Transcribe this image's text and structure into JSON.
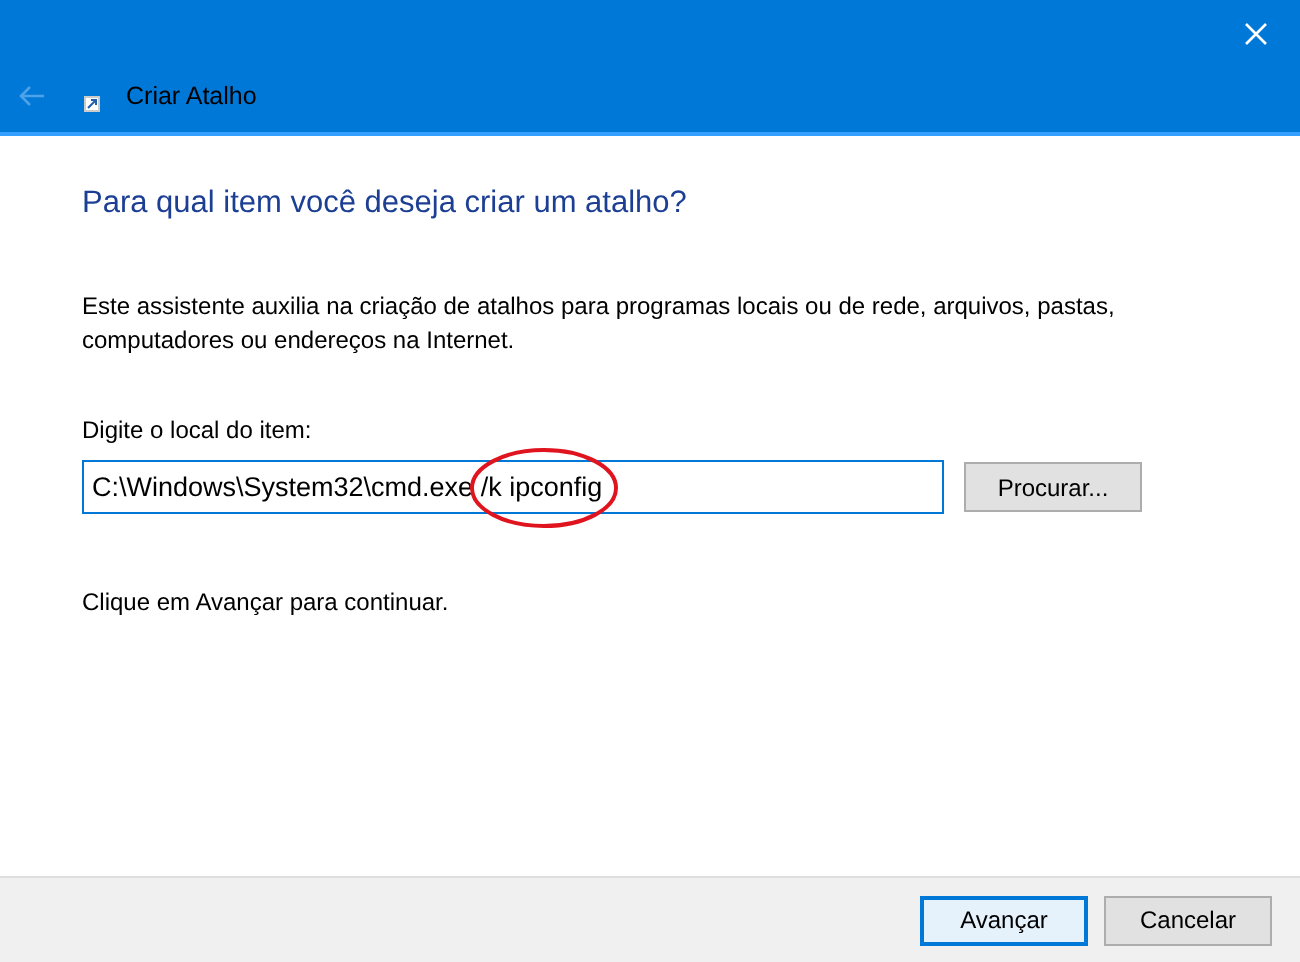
{
  "window": {
    "title": "Criar Atalho"
  },
  "back_button": {
    "disabled": true
  },
  "heading": "Para qual item você deseja criar um atalho?",
  "description": "Este assistente auxilia na criação de atalhos para programas locais ou de rede, arquivos, pastas, computadores ou endereços na Internet.",
  "location_field": {
    "label": "Digite o local do item:",
    "value": "C:\\Windows\\System32\\cmd.exe /k ipconfig"
  },
  "browse_button": "Procurar...",
  "hint": "Clique em Avançar para continuar.",
  "buttons": [
    {
      "label": "Avançar",
      "selected": true
    },
    {
      "label": "Cancelar",
      "selected": false
    }
  ]
}
